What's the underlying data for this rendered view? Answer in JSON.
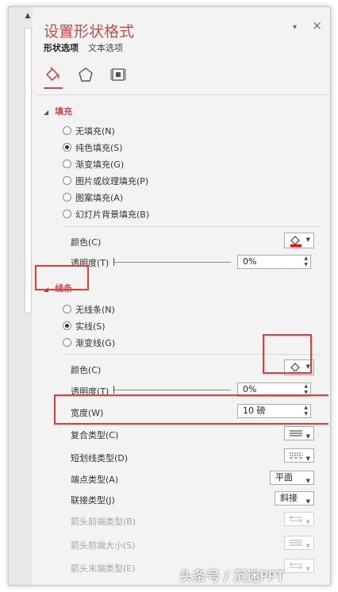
{
  "pane": {
    "title": "设置形状格式",
    "tabs": [
      {
        "label": "形状选项",
        "active": true
      },
      {
        "label": "文本选项",
        "active": false
      }
    ],
    "close_glyph": "×",
    "options_glyph": "▾",
    "accent": "#c0504d",
    "icons": [
      "fill-line-icon",
      "effects-pentagon-icon",
      "size-properties-icon"
    ]
  },
  "fill": {
    "header": "填充",
    "options": [
      {
        "label": "无填充(N)",
        "checked": false
      },
      {
        "label": "纯色填充(S)",
        "checked": true
      },
      {
        "label": "渐变填充(G)",
        "checked": false
      },
      {
        "label": "图片或纹理填充(P)",
        "checked": false
      },
      {
        "label": "图案填充(A)",
        "checked": false
      },
      {
        "label": "幻灯片背景填充(B)",
        "checked": false
      }
    ],
    "color_label": "颜色(C)",
    "color_swatch": "#ff0000",
    "transparency_label": "透明度(T)",
    "transparency_value": "0%"
  },
  "line": {
    "header": "线条",
    "options": [
      {
        "label": "无线条(N)",
        "checked": false
      },
      {
        "label": "实线(S)",
        "checked": true
      },
      {
        "label": "渐变线(G)",
        "checked": false
      }
    ],
    "color_label": "颜色(C)",
    "color_swatch": "#e8e8e8",
    "transparency_label": "透明度(T)",
    "transparency_value": "0%",
    "width_label": "宽度(W)",
    "width_value": "10 磅",
    "compound_label": "复合类型(C)",
    "dash_label": "短划线类型(D)",
    "cap_label": "端点类型(A)",
    "cap_value": "平面",
    "join_label": "联接类型(J)",
    "join_value": "斜接",
    "arrow_begin_type_label": "箭头前端类型(B)",
    "arrow_begin_size_label": "箭头前端大小(S)",
    "arrow_end_type_label": "箭头末端类型(E)"
  },
  "highlight_color": "#e23b3b",
  "watermark": "头条号 / 沉迷PPT"
}
